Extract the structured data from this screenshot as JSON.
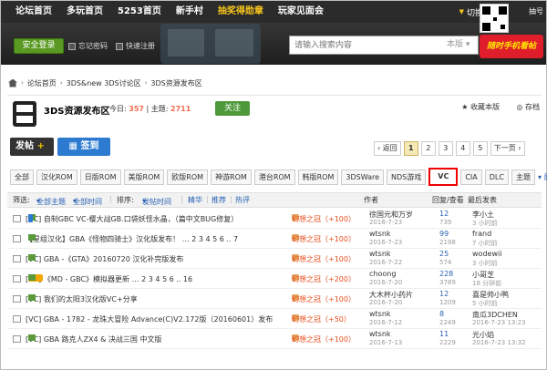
{
  "topnav": {
    "items": [
      "论坛首页",
      "多玩首页",
      "5253首页",
      "新手村",
      "抽奖得勋章",
      "玩家见面会"
    ],
    "highlight_index": 4,
    "switch_label": "切换",
    "lottery_label": "抽号",
    "tri_glyph": "▼"
  },
  "secbar": {
    "login_label": "安全登录",
    "remember_label": "忘记密码",
    "register_label": "快速注册",
    "search_placeholder": "请输入搜索内容",
    "search_scope": "本版",
    "search_scope_arrow": "▾",
    "banner_text": "随时手机看帖"
  },
  "breadcrumb": {
    "items": [
      "论坛首页",
      "3DS&new 3DS讨论区",
      "3DS资源发布区"
    ],
    "sep": "›"
  },
  "forum": {
    "title": "3DS资源发布区",
    "today_label": "今日:",
    "today_value": "357",
    "topics_label": "主题:",
    "topics_value": "2711",
    "follow_label": "关注",
    "fav_label": "收藏本版",
    "save_label": "存档"
  },
  "actions": {
    "post_label": "发帖",
    "post_plus": "+",
    "sign_label": "签到"
  },
  "pager": {
    "prev": "‹ 返回",
    "pages": [
      "1",
      "2",
      "3",
      "4",
      "5"
    ],
    "current": "1",
    "next": "下一页 ›"
  },
  "tabs": {
    "items": [
      "全部",
      "汉化ROM",
      "日版ROM",
      "美版ROM",
      "欧版ROM",
      "神游ROM",
      "港台ROM",
      "韩版ROM",
      "3DSWare",
      "NDS游戏",
      "VC",
      "CIA",
      "DLC",
      "主题"
    ],
    "active": "VC",
    "expand_label": "展开"
  },
  "filter": {
    "filter_label": "筛选:",
    "all_topics": "全部主题",
    "all_time": "全部时间",
    "sort_label": "排序:",
    "sort_value": "发帖时间",
    "digest": "精华",
    "recommend": "推荐",
    "hot": "热评",
    "author_col": "作者",
    "reply_col": "回复/查看",
    "last_col": "最后发表",
    "dropdown_glyph": "▾",
    "sep_glyph": "|"
  },
  "rows": [
    {
      "title": "[VC] 自制GBC VC-樱大战GB.口袋妖怪水晶，（篇中文BUG修复）",
      "hot": "幻想之冠（+100）",
      "author": "徐国元和万岁",
      "date": "2016-7-23",
      "replies": "12",
      "views": "739",
      "last": "李小土",
      "ltime": "3 小时前",
      "img": true,
      "phone": true,
      "newtag": false
    },
    {
      "title": "【星组汉化】GBA《怪物四骑士》汉化版发布！ … 2 3 4 5 6 .. 7",
      "hot": "幻想之冠（+100）",
      "author": "wtsnk",
      "date": "2016-7-23",
      "replies": "99",
      "views": "2198",
      "last": "frand",
      "ltime": "7 小时前",
      "img": true,
      "phone": false,
      "newtag": false
    },
    {
      "title": "[VC] GBA -《GTA》20160720 汉化补完版发布",
      "hot": "幻想之冠（+100）",
      "author": "wtsnk",
      "date": "2016-7-22",
      "replies": "25",
      "views": "574",
      "last": "wodewii",
      "ltime": "3 小时前",
      "img": true,
      "phone": false,
      "newtag": false
    },
    {
      "title": "[VC] 《MD - GBC》模拟器更新 … 2 3 4 5 6 .. 16",
      "hot": "幻想之冠（+200）",
      "author": "choong",
      "date": "2016-7-20",
      "replies": "228",
      "views": "3789",
      "last": "小哥芝",
      "ltime": "18 分钟前",
      "img": true,
      "phone": false,
      "newtag": true
    },
    {
      "title": "[VC] 我们的太阳3汉化版VC+分享",
      "hot": "幻想之冠（+100）",
      "author": "大木杯小药片",
      "date": "2016-7-20",
      "replies": "12",
      "views": "1209",
      "last": "喜是帅小鸭",
      "ltime": "5 小时前",
      "img": true,
      "phone": false,
      "newtag": false
    },
    {
      "title": "[VC] GBA - 1782 - 龙珠大冒险 Advance(C)V2.172版（20160601）发布",
      "hot": "幻想之冠（+50）",
      "author": "wtsnk",
      "date": "2016-7-12",
      "replies": "8",
      "views": "2249",
      "last": "南瓜3DCHEN",
      "ltime": "2016-7-23 13:23",
      "img": false,
      "phone": false,
      "newtag": false
    },
    {
      "title": "[VC] GBA 路克人ZX4 & 决战三国 中文版",
      "hot": "幻想之冠（+100）",
      "author": "wtsnk",
      "date": "2016-7-13",
      "replies": "11",
      "views": "2229",
      "last": "光小焰",
      "ltime": "2016-7-23 13:32",
      "img": true,
      "phone": false,
      "newtag": false
    }
  ]
}
